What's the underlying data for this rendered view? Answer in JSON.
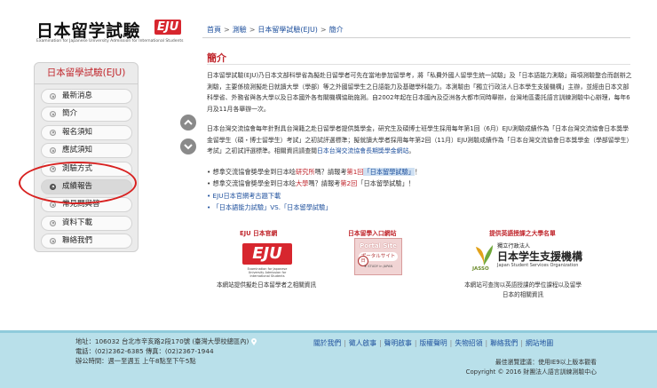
{
  "logo": {
    "title": "日本留学試驗",
    "badge": "EJU",
    "subtitle": "Examination for Japanese University Admission for International Students"
  },
  "breadcrumb": [
    "首頁",
    "測驗",
    "日本留學試驗(EJU)",
    "簡介"
  ],
  "breadcrumb_sep": ">",
  "sidebar": {
    "title": "日本留學試驗(EJU)",
    "items": [
      {
        "label": "最新消息"
      },
      {
        "label": "簡介"
      },
      {
        "label": "報名須知"
      },
      {
        "label": "應試須知"
      },
      {
        "label": "測驗方式"
      },
      {
        "label": "成績報告"
      },
      {
        "label": "常見問與答"
      },
      {
        "label": "資料下載"
      },
      {
        "label": "聯絡我們"
      }
    ]
  },
  "main": {
    "title": "簡介",
    "para1": "日本留學試驗(EJU)乃日本文部科學省為擬赴日留學者可先在當地參加留學考，將「私費外國人留學生統一試驗」及「日本語能力測驗」兩項測驗整合而創辦之測驗，主要係檢測擬赴日就讀大學（學部）等之外國留學生之日語能力及基礎學科能力。本測驗由「獨立行政法人日本學生支援機構」主辦，並經由日本文部科學省、外務省與各大學以及日本國外各有關機構協助施測。自2002年起在日本國內及亞洲各大都市同時舉辦，台灣地區委託語言訓練測驗中心辦理，每年6月及11月各舉辦一次。",
    "para2_a": "日本台灣交流協會每年針對具台灣籍之赴日留學者提供獎學金，研究生及碩博士班學生採用每年第1回（6月）EJU測驗成績作為「日本台灣交流協會日本獎學金留學生（碩・博士留學生）考試」之初試評選標準；擬就讀大學者採用每年第2回（11月）EJU測驗成績作為「日本台灣交流協會日本獎學金（學部留學生）考試」之初試評選標準。相關資訊請查閱",
    "para2_link": "日本台灣交流協會長期獎學金網站",
    "para2_b": "。",
    "bullets": [
      {
        "a": "想拿交流協會獎學金到日本唸",
        "b": "研究所",
        "c": "嗎？請報考",
        "d": "第1回",
        "e": "「日本留學試驗」",
        "f": "！"
      },
      {
        "a": "想拿交流協會獎學金到日本唸",
        "b": "大學",
        "c": "嗎？請報考",
        "d": "第2回",
        "e": "「日本留學試驗」",
        "f": "！"
      }
    ],
    "bullet_links": [
      "EJU日本官網考古題下載",
      "「日本語能力試驗」VS.「日本留學試驗」"
    ]
  },
  "columns": {
    "eju": {
      "heading": "EJU 日本官網",
      "badge": "EJU",
      "badge_sub": "Examination for Japanese University Admission for International Students",
      "desc": "本網站提供擬赴日本留學者之相關資訊"
    },
    "portal": {
      "heading": "日本留學入口網站",
      "line1": "Portal Site",
      "line2": "ポータルサイト",
      "line3": "★ STUDY in JAPAN",
      "stamp": "日",
      "desc": ""
    },
    "jasso": {
      "heading": "提供英語授課之大學名單",
      "l1": "獨立行政法人",
      "l2": "日本学生支援機構",
      "l3": "Japan Student Services Organization",
      "logo_text": "JASSO",
      "desc_line1": "本網站可查詢以英語授課的學位課程以及留學",
      "desc_line2": "日本的相關資訊"
    }
  },
  "footer": {
    "addr1": "地址：106032 台北市辛亥路2段170號 (臺灣大學校總區內)",
    "addr2": "電話：(02)2362-6385  傳真：(02)2367-1944",
    "addr3": "辦公時間：週一至週五 上午8點至下午5點",
    "links": [
      "關於我們",
      "徵人啟事",
      "聲明啟事",
      "版權聲明",
      "失物招領",
      "聯絡我們",
      "網站地圖"
    ],
    "browser": "最佳瀏覽建議：使用IE9以上版本觀看",
    "copyright": "Copyright © 2016 財團法人語言訓練測驗中心"
  },
  "colors": {
    "accent_red": "#c0262c",
    "link_blue": "#1d4f9c",
    "footer_bg": "#b9e0ea"
  }
}
